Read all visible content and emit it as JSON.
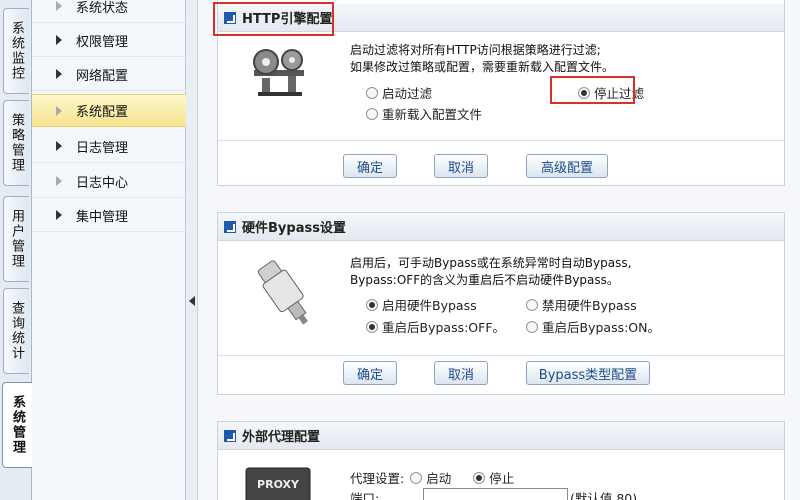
{
  "vertical_tabs": [
    {
      "label": "系统监控"
    },
    {
      "label": "策略管理"
    },
    {
      "label": "用户管理"
    },
    {
      "label": "查询统计"
    },
    {
      "label": "系统管理"
    }
  ],
  "sidebar": {
    "items": [
      {
        "label": "系统状态"
      },
      {
        "label": "权限管理"
      },
      {
        "label": "网络配置"
      },
      {
        "label": "系统配置",
        "active": true
      },
      {
        "label": "日志管理"
      },
      {
        "label": "日志中心"
      },
      {
        "label": "集中管理"
      }
    ]
  },
  "http_panel": {
    "title": "HTTP引擎配置",
    "icon": "gears-icon",
    "desc_line1": "启动过滤将对所有HTTP访问根据策略进行过滤;",
    "desc_line2": "如果修改过策略或配置，需要重新载入配置文件。",
    "radio_start": "启动过滤",
    "radio_stop": "停止过滤",
    "radio_reload": "重新载入配置文件",
    "btn_ok": "确定",
    "btn_cancel": "取消",
    "btn_advanced": "高级配置"
  },
  "bypass_panel": {
    "title": "硬件Bypass设置",
    "icon": "bypass-plug-icon",
    "desc_line1": "启用后，可手动Bypass或在系统异常时自动Bypass,",
    "desc_line2": "Bypass:OFF的含义为重启后不启动硬件Bypass。",
    "radio_enable": "启用硬件Bypass",
    "radio_disable": "禁用硬件Bypass",
    "radio_off": "重启后Bypass:OFF。",
    "radio_on": "重启后Bypass:ON。",
    "btn_ok": "确定",
    "btn_cancel": "取消",
    "btn_type": "Bypass类型配置"
  },
  "proxy_panel": {
    "title": "外部代理配置",
    "icon": "proxy-chip-icon",
    "chip_text": "PROXY",
    "proxy_label": "代理设置:",
    "radio_start": "启动",
    "radio_stop": "停止",
    "port_label": "端口:",
    "port_hint": "(默认值 80)"
  }
}
